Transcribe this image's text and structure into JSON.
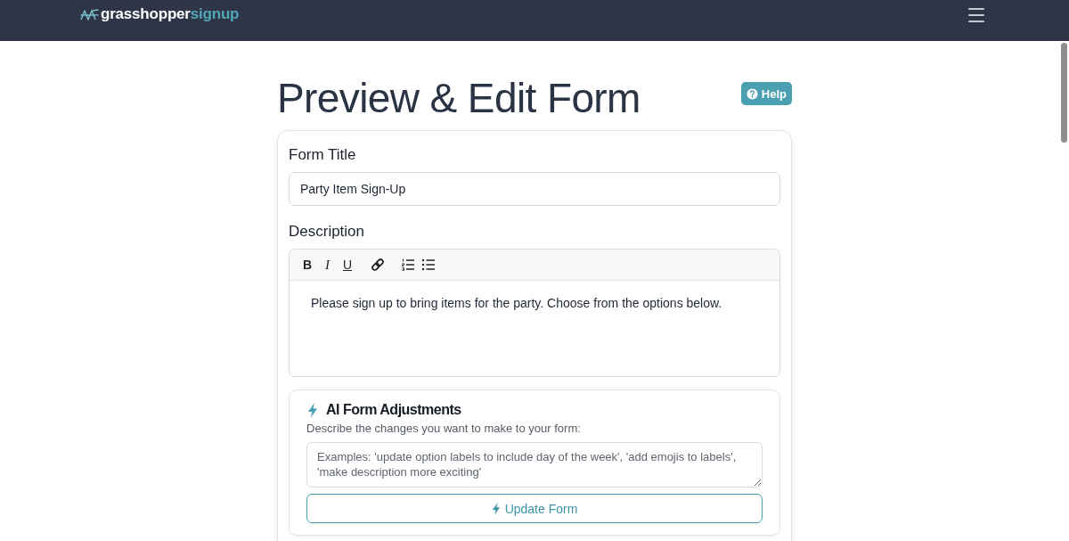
{
  "navbar": {
    "brand": {
      "name": "grasshopper",
      "suffix": "signup"
    }
  },
  "header": {
    "title": "Preview & Edit Form",
    "help_button": "Help"
  },
  "form_title": {
    "label": "Form Title",
    "value": "Party Item Sign-Up"
  },
  "description": {
    "label": "Description",
    "toolbar": [
      {
        "buttons": [
          {
            "kind": "bold",
            "label": "B"
          },
          {
            "kind": "italic",
            "label": "I"
          },
          {
            "kind": "underline",
            "label": "U"
          }
        ]
      },
      {
        "buttons": [
          {
            "kind": "link"
          }
        ]
      },
      {
        "buttons": [
          {
            "kind": "ordered-list"
          },
          {
            "kind": "bullet-list"
          }
        ]
      }
    ],
    "value": "Please sign up to bring items for the party. Choose from the options below."
  },
  "ai_adjustments": {
    "title": "AI Form Adjustments",
    "instructions": "Describe the changes you want to make to your form:",
    "placeholder": "Examples: 'update option labels to include day of the week', 'add emojis to labels', 'make description more exciting'",
    "button": "Update Form"
  }
}
